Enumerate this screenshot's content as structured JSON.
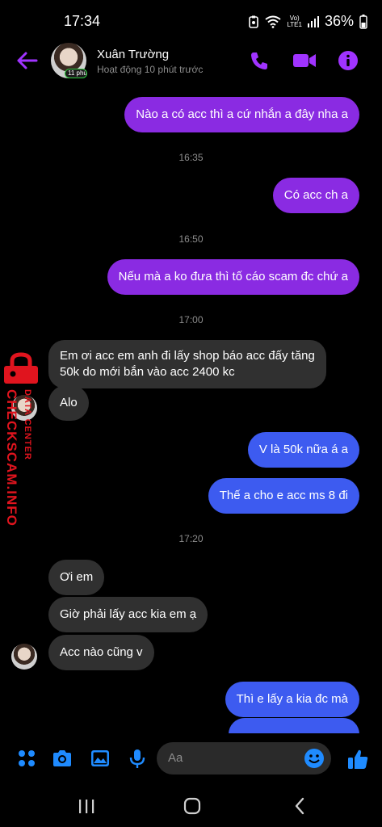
{
  "status_bar": {
    "time": "17:34",
    "network_top": "Vo)",
    "network_bottom": "LTE1",
    "battery": "36%"
  },
  "header": {
    "contact_name": "Xuân Trường",
    "contact_status": "Hoạt động 10 phút trước",
    "avatar_badge": "11 phút"
  },
  "messages": [
    {
      "type": "out",
      "color": "purple",
      "text": "Nào a có acc thì a cứ nhắn a đây nha a"
    },
    {
      "type": "time",
      "text": "16:35"
    },
    {
      "type": "out",
      "color": "purple",
      "text": "Có acc ch a"
    },
    {
      "type": "time",
      "text": "16:50"
    },
    {
      "type": "out",
      "color": "purple",
      "text": "Nếu mà a ko đưa thì tố cáo scam đc chứ a"
    },
    {
      "type": "time",
      "text": "17:00"
    },
    {
      "type": "in",
      "text_line1": "Em ơi acc em anh đi lấy shop báo acc đấy tăng",
      "text_line2": "50k do mới bắn vào acc 2400 kc"
    },
    {
      "type": "in",
      "text": "Alo"
    },
    {
      "type": "out",
      "color": "blue",
      "text": "V là 50k nữa á a"
    },
    {
      "type": "out",
      "color": "blue",
      "text": "Thế a cho e acc ms 8 đi"
    },
    {
      "type": "time",
      "text": "17:20"
    },
    {
      "type": "in",
      "text": "Ơi em"
    },
    {
      "type": "in",
      "text": "Giờ phải lấy acc kia em ạ"
    },
    {
      "type": "in",
      "text": "Acc nào cũng v"
    },
    {
      "type": "out",
      "color": "blue",
      "text": "Thì e lấy a kia đc mà"
    }
  ],
  "watermark": {
    "line1": "DATA CENTER",
    "line2": "CHECKSCAM.INFO"
  },
  "composer": {
    "placeholder": "Aa"
  },
  "colors": {
    "accent_purple": "#a033ff",
    "bubble_purple": "#8a2be2",
    "bubble_blue": "#3d5bf0",
    "bubble_in": "#303030",
    "composer_blue": "#1f8bff",
    "watermark_red": "#e0141e"
  },
  "icons": {
    "header": [
      "back-arrow-icon",
      "phone-icon",
      "video-camera-icon",
      "info-icon"
    ],
    "composer": [
      "apps-grid-icon",
      "camera-icon",
      "gallery-icon",
      "microphone-icon",
      "emoji-icon",
      "thumbs-up-icon"
    ],
    "nav": [
      "recent-apps-icon",
      "home-icon",
      "back-icon"
    ]
  }
}
